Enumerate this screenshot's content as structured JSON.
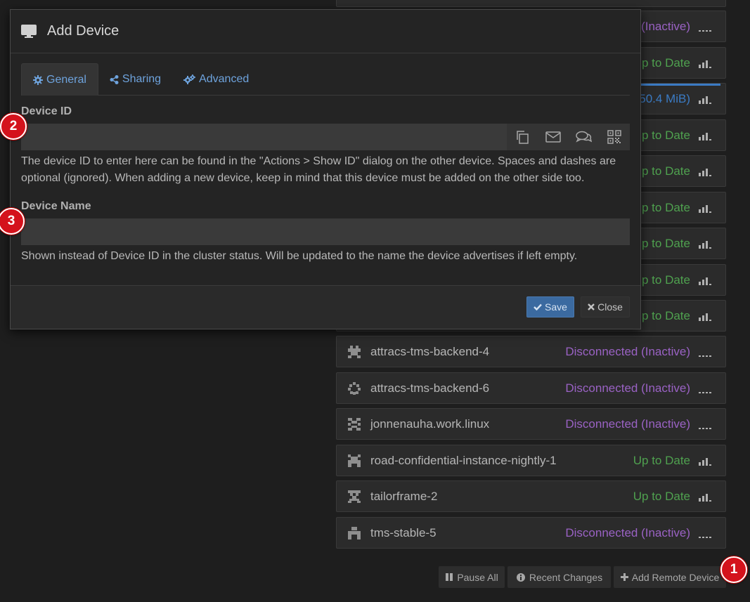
{
  "modal": {
    "title": "Add Device",
    "tabs": [
      {
        "label": "General"
      },
      {
        "label": "Sharing"
      },
      {
        "label": "Advanced"
      }
    ],
    "device_id": {
      "label": "Device ID",
      "value": "",
      "help": "The device ID to enter here can be found in the \"Actions > Show ID\" dialog on the other device. Spaces and dashes are optional (ignored). When adding a new device, keep in mind that this device must be added on the other side too."
    },
    "device_name": {
      "label": "Device Name",
      "value": "",
      "help": "Shown instead of Device ID in the cluster status. Will be updated to the name the device advertises if left empty."
    },
    "save_label": "Save",
    "close_label": "Close"
  },
  "devices": [
    {
      "name": "",
      "status": "(Inactive)",
      "state": "inactive"
    },
    {
      "name": "",
      "status": "p to Date",
      "state": "ok"
    },
    {
      "name": "",
      "status": "50.4 MiB)",
      "state": "syncing"
    },
    {
      "name": "",
      "status": "p to Date",
      "state": "ok"
    },
    {
      "name": "",
      "status": "p to Date",
      "state": "ok"
    },
    {
      "name": "",
      "status": "p to Date",
      "state": "ok"
    },
    {
      "name": "",
      "status": "p to Date",
      "state": "ok"
    },
    {
      "name": "",
      "status": "p to Date",
      "state": "ok"
    },
    {
      "name": "",
      "status": "p to Date",
      "state": "ok"
    },
    {
      "name": "attracs-tms-backend-4",
      "status": "Disconnected (Inactive)",
      "state": "inactive"
    },
    {
      "name": "attracs-tms-backend-6",
      "status": "Disconnected (Inactive)",
      "state": "inactive"
    },
    {
      "name": "jonnenauha.work.linux",
      "status": "Disconnected (Inactive)",
      "state": "inactive"
    },
    {
      "name": "road-confidential-instance-nightly-1",
      "status": "Up to Date",
      "state": "ok"
    },
    {
      "name": "tailorframe-2",
      "status": "Up to Date",
      "state": "ok"
    },
    {
      "name": "tms-stable-5",
      "status": "Disconnected (Inactive)",
      "state": "inactive"
    }
  ],
  "actions": {
    "pause_all": "Pause All",
    "recent_changes": "Recent Changes",
    "add_remote_device": "Add Remote Device"
  },
  "markers": [
    "1",
    "2",
    "3"
  ],
  "colors": {
    "accent": "#6ea3dd",
    "inactive": "#9a62c4",
    "up_to_date": "#4fa14f",
    "marker": "#d4121c"
  }
}
